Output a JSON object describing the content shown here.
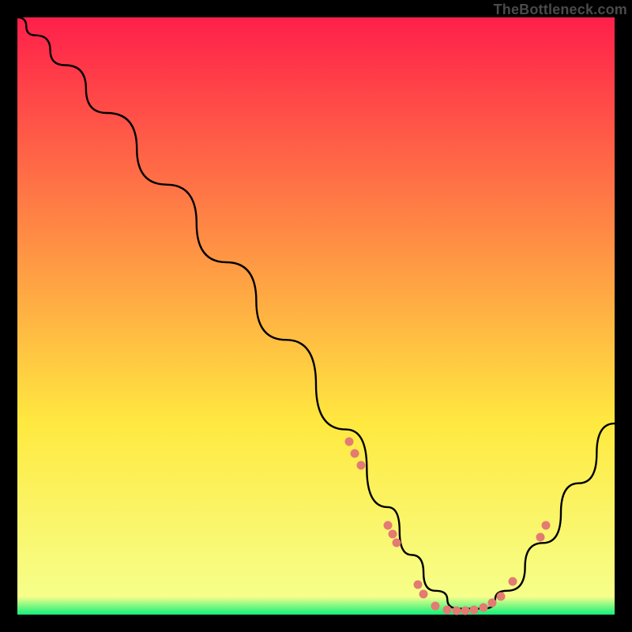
{
  "watermark": "TheBottleneck.com",
  "gradient": {
    "top": "#ff1f4a",
    "mid": "#ffe940",
    "bottom": "#0ff07a"
  },
  "chart_data": {
    "type": "line",
    "title": "",
    "xlabel": "",
    "ylabel": "",
    "xlim": [
      0,
      100
    ],
    "ylim": [
      0,
      100
    ],
    "grid": false,
    "series": [
      {
        "name": "bottleneck-curve",
        "x": [
          0,
          3,
          8,
          15,
          25,
          35,
          45,
          55,
          62,
          66,
          70,
          74,
          78,
          82,
          88,
          94,
          100
        ],
        "y": [
          100,
          97,
          92,
          84,
          72,
          59,
          46,
          31,
          18,
          10,
          4,
          1,
          1,
          4,
          12,
          22,
          32
        ]
      }
    ],
    "scatter": [
      {
        "name": "dots-left-branch",
        "points": [
          {
            "x": 55.5,
            "y": 29
          },
          {
            "x": 56.5,
            "y": 27
          },
          {
            "x": 57.5,
            "y": 25
          },
          {
            "x": 62,
            "y": 15
          },
          {
            "x": 62.8,
            "y": 13.5
          },
          {
            "x": 63.5,
            "y": 12
          },
          {
            "x": 67,
            "y": 5
          },
          {
            "x": 68,
            "y": 3.5
          },
          {
            "x": 70,
            "y": 1.5
          },
          {
            "x": 72,
            "y": 0.8
          },
          {
            "x": 73.5,
            "y": 0.6
          },
          {
            "x": 75,
            "y": 0.6
          },
          {
            "x": 76.5,
            "y": 0.8
          },
          {
            "x": 78,
            "y": 1.2
          },
          {
            "x": 79.5,
            "y": 2
          },
          {
            "x": 81,
            "y": 3
          },
          {
            "x": 83,
            "y": 5.5
          }
        ]
      },
      {
        "name": "dots-right-branch",
        "points": [
          {
            "x": 87.5,
            "y": 13
          },
          {
            "x": 88.5,
            "y": 15
          }
        ]
      }
    ],
    "annotations": []
  }
}
